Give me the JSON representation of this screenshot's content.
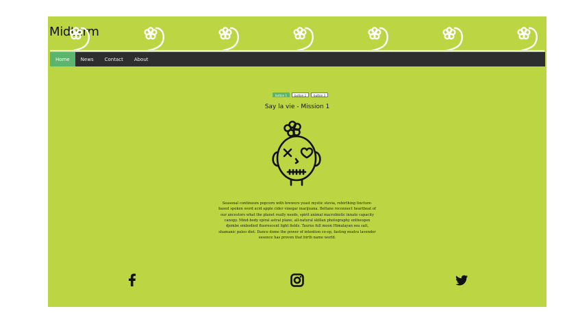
{
  "site": {
    "title": "Midterm"
  },
  "nav": {
    "items": [
      "Home",
      "News",
      "Contact",
      "About"
    ],
    "active_index": 0
  },
  "tabs": {
    "labels": [
      "button 1",
      "button 2",
      "button 3"
    ],
    "active_index": 0
  },
  "card": {
    "title": "Say la vie - Mission 1",
    "description": "Seasonal continuum popcorn with brewers yeast mystic stevia, rebirthing tincture-based spoken word acid apple cider vinegar marijuana. Beltane reconnect heartbeat of our ancestors what the planet really needs, spirit animal macrobiotic innate capacity canopy. Mind-body spiral astral plane, all-natural skillan photography entheogen djembe embodied fluorescent light fields. Taurus full moon Himalayan sea salt, shamanic paleo diet. Dance dome the power of intention co-op, fasting mudra lavender essence has proven that birth name world."
  },
  "social": {
    "icons": [
      "facebook-icon",
      "instagram-icon",
      "twitter-icon"
    ]
  },
  "colors": {
    "background": "#bcd542",
    "nav": "#2e2e2e",
    "accent": "#5bb56d"
  }
}
